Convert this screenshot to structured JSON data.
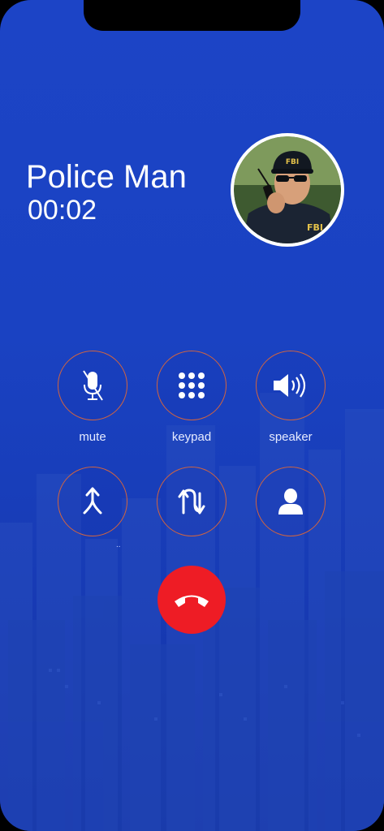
{
  "call": {
    "caller_name": "Police Man",
    "duration": "00:02"
  },
  "controls": [
    {
      "id": "mute",
      "label": "mute",
      "icon": "mic-off-icon"
    },
    {
      "id": "keypad",
      "label": "keypad",
      "icon": "keypad-icon"
    },
    {
      "id": "speaker",
      "label": "speaker",
      "icon": "speaker-icon"
    },
    {
      "id": "merge",
      "label": "",
      "icon": "merge-calls-icon"
    },
    {
      "id": "swap",
      "label": "..",
      "icon": "swap-calls-icon"
    },
    {
      "id": "contacts",
      "label": "",
      "icon": "contact-icon"
    }
  ],
  "end_call": {
    "icon": "end-call-icon"
  },
  "avatar": {
    "cap_text": "FBI",
    "jacket_text": "FBI"
  },
  "colors": {
    "background": "#1c44c6",
    "control_ring": "#d2643f",
    "end_call": "#ee1c25"
  }
}
